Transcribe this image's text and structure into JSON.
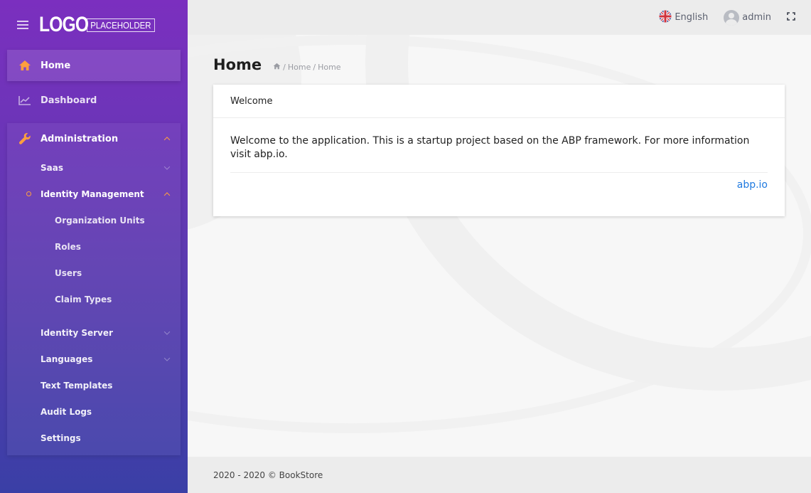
{
  "brand": {
    "logo_main": "LOGO",
    "logo_sub": "PLACEHOLDER"
  },
  "sidebar": {
    "items": [
      {
        "label": "Home",
        "icon": "home-icon"
      },
      {
        "label": "Dashboard",
        "icon": "chart-line-icon"
      },
      {
        "label": "Administration",
        "icon": "wrench-icon"
      }
    ],
    "admin_children": [
      {
        "label": "Saas"
      },
      {
        "label": "Identity Management"
      }
    ],
    "identity_children": [
      {
        "label": "Organization Units"
      },
      {
        "label": "Roles"
      },
      {
        "label": "Users"
      },
      {
        "label": "Claim Types"
      }
    ],
    "more_children": [
      {
        "label": "Identity Server"
      },
      {
        "label": "Languages"
      },
      {
        "label": "Text Templates"
      },
      {
        "label": "Audit Logs"
      },
      {
        "label": "Settings"
      }
    ]
  },
  "topbar": {
    "language": "English",
    "user": "admin"
  },
  "page": {
    "title": "Home",
    "breadcrumb": [
      "Home",
      "Home"
    ]
  },
  "card": {
    "header": "Welcome",
    "body": "Welcome to the application. This is a startup project based on the ABP framework. For more information visit abp.io.",
    "link": "abp.io"
  },
  "footer": {
    "text": "2020 - 2020 © BookStore"
  },
  "colors": {
    "accent": "#ff9f3e",
    "link": "#1f7ae0",
    "sidebar_top": "#7b2fbf",
    "sidebar_bottom": "#3a3fa6"
  }
}
